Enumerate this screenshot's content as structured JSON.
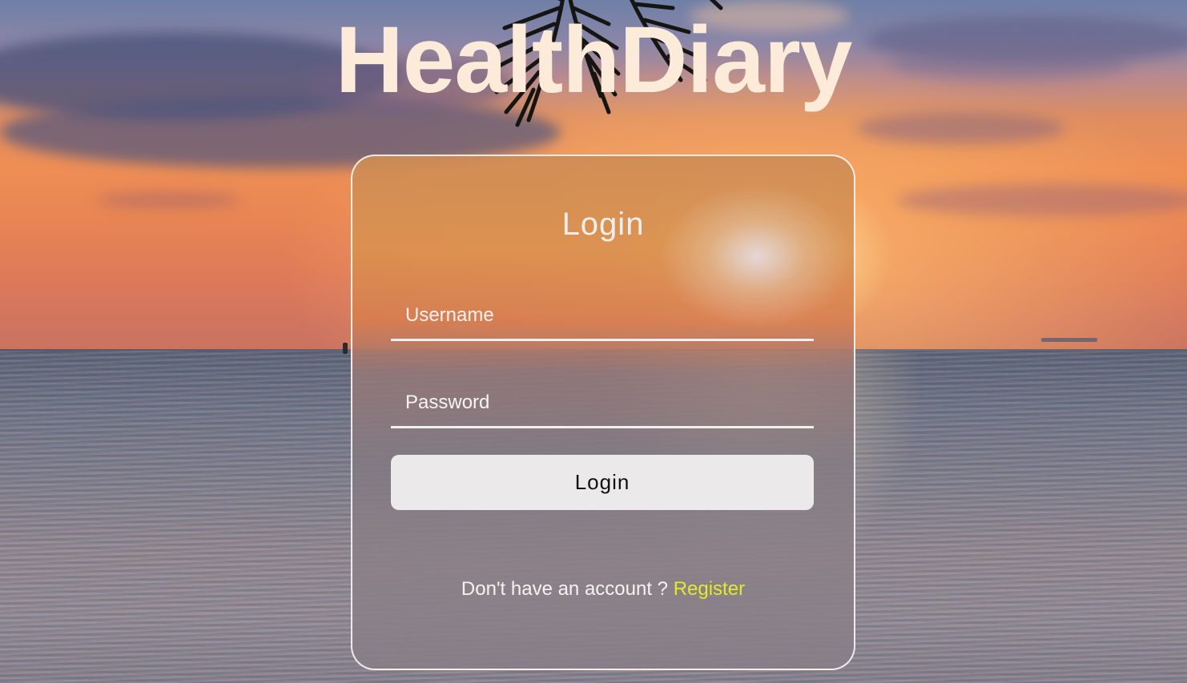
{
  "app": {
    "title": "HealthDiary"
  },
  "login_form": {
    "heading": "Login",
    "username": {
      "placeholder": "Username",
      "value": ""
    },
    "password": {
      "placeholder": "Password",
      "value": ""
    },
    "submit_label": "Login",
    "register_prompt": "Don't have an account ?",
    "register_link": "Register"
  },
  "colors": {
    "title": "#fbebd8",
    "register_link": "#e3ea2a",
    "button_bg": "#ebe9e9",
    "card_border": "#ffffff"
  }
}
